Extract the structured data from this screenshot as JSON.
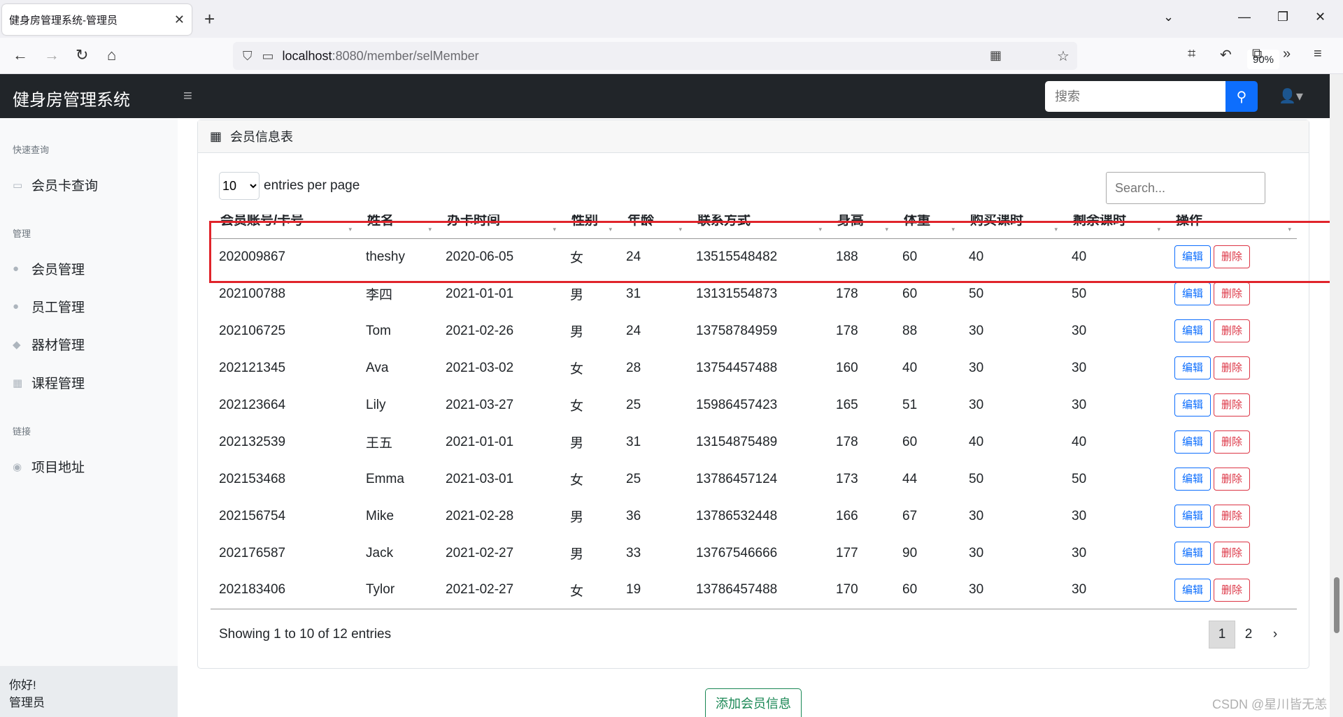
{
  "browser": {
    "tab_title": "健身房管理系统-管理员",
    "url_host": "localhost",
    "url_path": ":8080/member/selMember",
    "zoom": "90%"
  },
  "header": {
    "brand": "健身房管理系统",
    "search_placeholder": "搜索"
  },
  "sidebar": {
    "sections": [
      {
        "heading": "快速查询",
        "items": [
          {
            "label": "会员卡查询",
            "icon": "id-card-icon"
          }
        ]
      },
      {
        "heading": "管理",
        "items": [
          {
            "label": "会员管理",
            "icon": "user-icon"
          },
          {
            "label": "员工管理",
            "icon": "user-tie-icon"
          },
          {
            "label": "器材管理",
            "icon": "dumbbell-icon"
          },
          {
            "label": "课程管理",
            "icon": "calendar-icon"
          }
        ]
      },
      {
        "heading": "链接",
        "items": [
          {
            "label": "项目地址",
            "icon": "github-icon"
          }
        ]
      }
    ],
    "footer_greeting": "你好!",
    "footer_role": "管理员"
  },
  "card": {
    "title": "会员信息表",
    "per_page_value": "10",
    "per_page_label": "entries per page",
    "search_placeholder": "Search...",
    "columns": [
      "会员账号/卡号",
      "姓名",
      "办卡时间",
      "性别",
      "年龄",
      "联系方式",
      "身高",
      "体重",
      "购买课时",
      "剩余课时",
      "操作"
    ],
    "rows": [
      [
        "202009867",
        "theshy",
        "2020-06-05",
        "女",
        "24",
        "13515548482",
        "188",
        "60",
        "40",
        "40"
      ],
      [
        "202100788",
        "李四",
        "2021-01-01",
        "男",
        "31",
        "13131554873",
        "178",
        "60",
        "50",
        "50"
      ],
      [
        "202106725",
        "Tom",
        "2021-02-26",
        "男",
        "24",
        "13758784959",
        "178",
        "88",
        "30",
        "30"
      ],
      [
        "202121345",
        "Ava",
        "2021-03-02",
        "女",
        "28",
        "13754457488",
        "160",
        "40",
        "30",
        "30"
      ],
      [
        "202123664",
        "Lily",
        "2021-03-27",
        "女",
        "25",
        "15986457423",
        "165",
        "51",
        "30",
        "30"
      ],
      [
        "202132539",
        "王五",
        "2021-01-01",
        "男",
        "31",
        "13154875489",
        "178",
        "60",
        "40",
        "40"
      ],
      [
        "202153468",
        "Emma",
        "2021-03-01",
        "女",
        "25",
        "13786457124",
        "173",
        "44",
        "50",
        "50"
      ],
      [
        "202156754",
        "Mike",
        "2021-02-28",
        "男",
        "36",
        "13786532448",
        "166",
        "67",
        "30",
        "30"
      ],
      [
        "202176587",
        "Jack",
        "2021-02-27",
        "男",
        "33",
        "13767546666",
        "177",
        "90",
        "30",
        "30"
      ],
      [
        "202183406",
        "Tylor",
        "2021-02-27",
        "女",
        "19",
        "13786457488",
        "170",
        "60",
        "30",
        "30"
      ]
    ],
    "edit_label": "编辑",
    "delete_label": "删除",
    "showing": "Showing 1 to 10 of 12 entries",
    "pages": [
      "1",
      "2",
      "›"
    ]
  },
  "add_button": "添加会员信息",
  "watermark": "CSDN @星川皆无恙",
  "colors": {
    "accent": "#0d6efd",
    "danger": "#dc3545",
    "success": "#198754",
    "highlight": "#e0242b"
  }
}
